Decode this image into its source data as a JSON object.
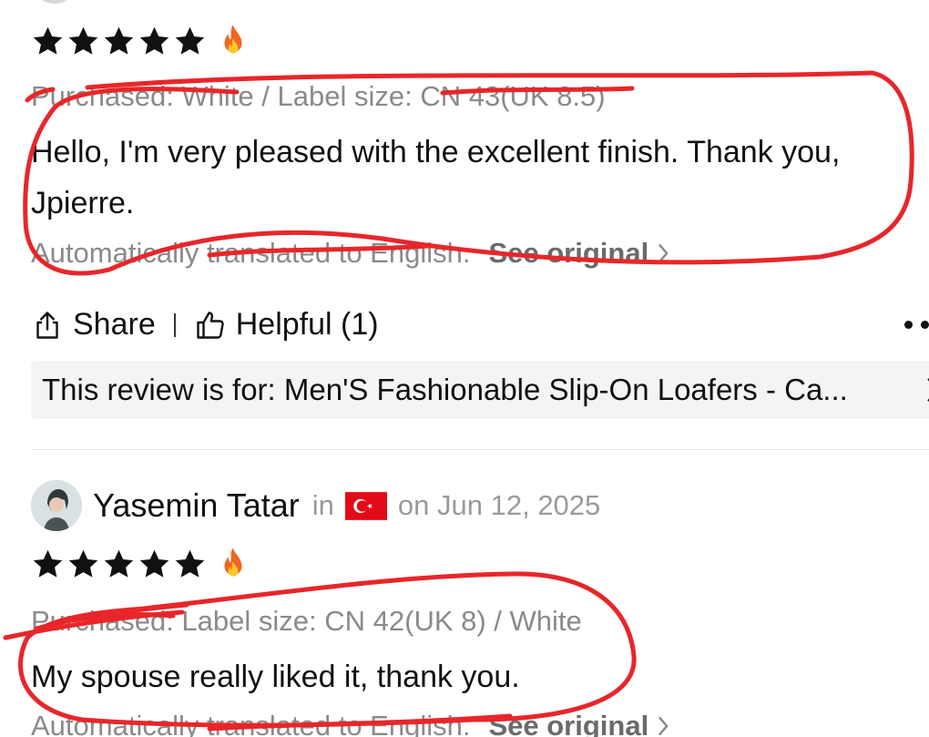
{
  "review1": {
    "rating": 5,
    "rating_emoji": "fire-emoji",
    "purchased": "Purchased: White / Label size: CN 43(UK 8.5)",
    "body": "Hello, I'm very pleased with the excellent finish. Thank you, Jpierre.",
    "translated_note": "Automatically translated to English.",
    "see_original": "See original",
    "share_label": "Share",
    "helpful_label": "Helpful (1)",
    "review_for": "This review is for: Men'S Fashionable Slip-On Loafers - Ca..."
  },
  "review2": {
    "reviewer_name": "Yasemin Tatar",
    "in_label": "in",
    "country_flag": "turkey-flag",
    "date": "on Jun 12, 2025",
    "rating": 5,
    "rating_emoji": "fire-emoji",
    "purchased": "Purchased: Label size: CN 42(UK 8) / White",
    "body": "My spouse really liked it, thank you.",
    "translated_note": "Automatically translated to English.",
    "see_original": "See original"
  },
  "annotation_color": "#e8262a"
}
